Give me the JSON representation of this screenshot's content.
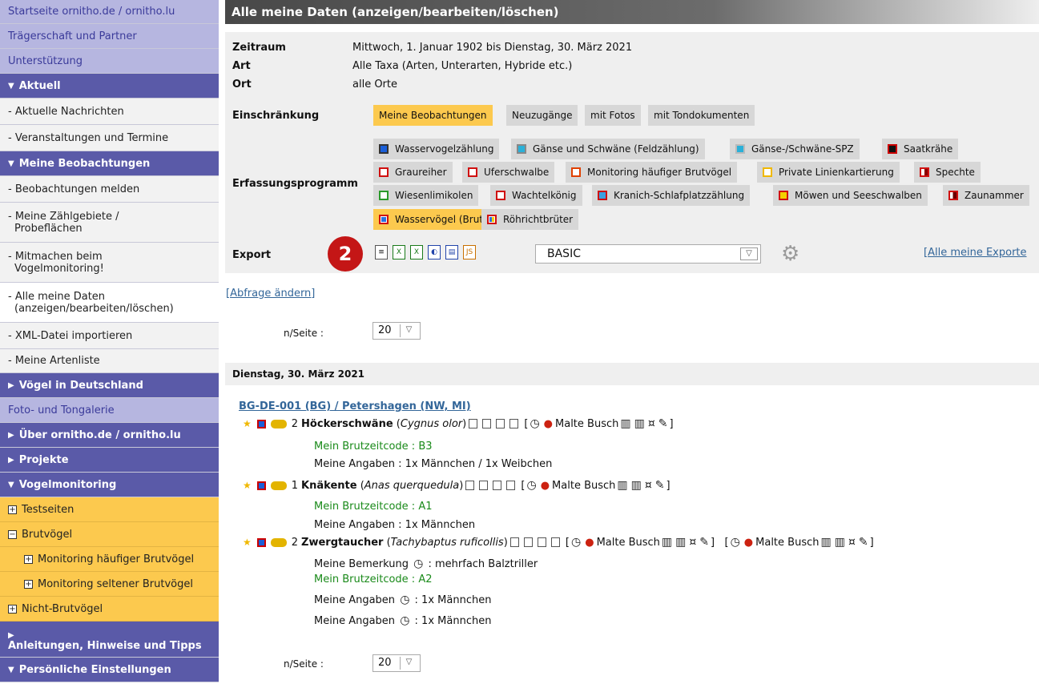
{
  "sidebar": {
    "items": [
      "Startseite ornitho.de / ornitho.lu",
      "Trägerschaft und Partner",
      "Unterstützung",
      "Aktuell",
      "- Aktuelle Nachrichten",
      "- Veranstaltungen und Termine",
      "Meine Beobachtungen",
      "- Beobachtungen melden",
      "- Meine Zählgebiete /",
      "Probeflächen",
      "- Mitmachen beim",
      "Vogelmonitoring!",
      "- Alle meine Daten",
      "(anzeigen/bearbeiten/löschen)",
      "- XML-Datei importieren",
      "- Meine Artenliste",
      "Vögel in Deutschland",
      "Foto- und Tongalerie",
      "Über ornitho.de / ornitho.lu",
      "Projekte",
      "Vogelmonitoring",
      "Testseiten",
      "Brutvögel",
      "Monitoring häufiger Brutvögel",
      "Monitoring seltener Brutvögel",
      "Nicht-Brutvögel",
      "Anleitungen, Hinweise und Tipps",
      "Persönliche Einstellungen"
    ]
  },
  "main": {
    "title": "Alle meine Daten (anzeigen/bearbeiten/löschen)",
    "zeitraum_label": "Zeitraum",
    "zeitraum_value": "Mittwoch, 1. Januar 1902 bis Dienstag, 30. März 2021",
    "art_label": "Art",
    "art_value": "Alle Taxa (Arten, Unterarten, Hybride etc.)",
    "ort_label": "Ort",
    "ort_value": "alle Orte",
    "einschraenkung_label": "Einschränkung",
    "einschraenkung_tags": [
      "Meine Beobachtungen",
      "Neuzugänge",
      "mit Fotos",
      "mit Tondokumenten"
    ],
    "erfassung_label": "Erfassungsprogramm",
    "programs": [
      "Wasservogelzählung",
      "Gänse und Schwäne (Feldzählung)",
      "Gänse-/Schwäne-SPZ",
      "Saatkrähe",
      "Graureiher",
      "Uferschwalbe",
      "Monitoring häufiger Brutvögel",
      "Private Linienkartierung",
      "Spechte",
      "Wiesenlimikolen",
      "Wachtelkönig",
      "Kranich-Schlafplatzzählung",
      "Möwen und Seeschwalben",
      "Zaunammer",
      "Wasservögel (Brut)",
      "Röhrichtbrüter"
    ],
    "badge": "2",
    "export_label": "Export",
    "export_format": "BASIC",
    "all_exports_link": "[Alle meine Exporte",
    "change_query_link": "[Abfrage ändern]",
    "per_page_label": "n/Seite :",
    "per_page_value": "20",
    "day_header": "Dienstag, 30. März 2021",
    "location_link": "BG-DE-001 (BG) / Petershagen (NW, MI)",
    "observations": [
      {
        "count": "2",
        "species": "Höckerschwäne",
        "latin": "Cygnus olor",
        "observer": "Malte Busch",
        "lines": [
          "Mein Brutzeitcode : B3",
          "Meine Angaben : 1x Männchen / 1x Weibchen"
        ]
      },
      {
        "count": "1",
        "species": "Knäkente",
        "latin": "Anas querquedula",
        "observer": "Malte Busch",
        "lines": [
          "Mein Brutzeitcode : A1",
          "Meine Angaben : 1x Männchen"
        ]
      },
      {
        "count": "2",
        "species": "Zwergtaucher",
        "latin": "Tachybaptus ruficollis",
        "observer": "Malte Busch",
        "observer2": "Malte Busch",
        "lines": [
          "Meine Bemerkung",
          ": mehrfach Balztriller",
          "Mein Brutzeitcode : A2",
          "Meine Angaben",
          ": 1x Männchen",
          "Meine Angaben",
          ": 1x Männchen"
        ]
      }
    ]
  },
  "colors": {
    "sidebar_link": "#b6b6e0",
    "sidebar_head": "#5a5aa8",
    "orange": "#fcc94e",
    "badge": "#c41616"
  }
}
